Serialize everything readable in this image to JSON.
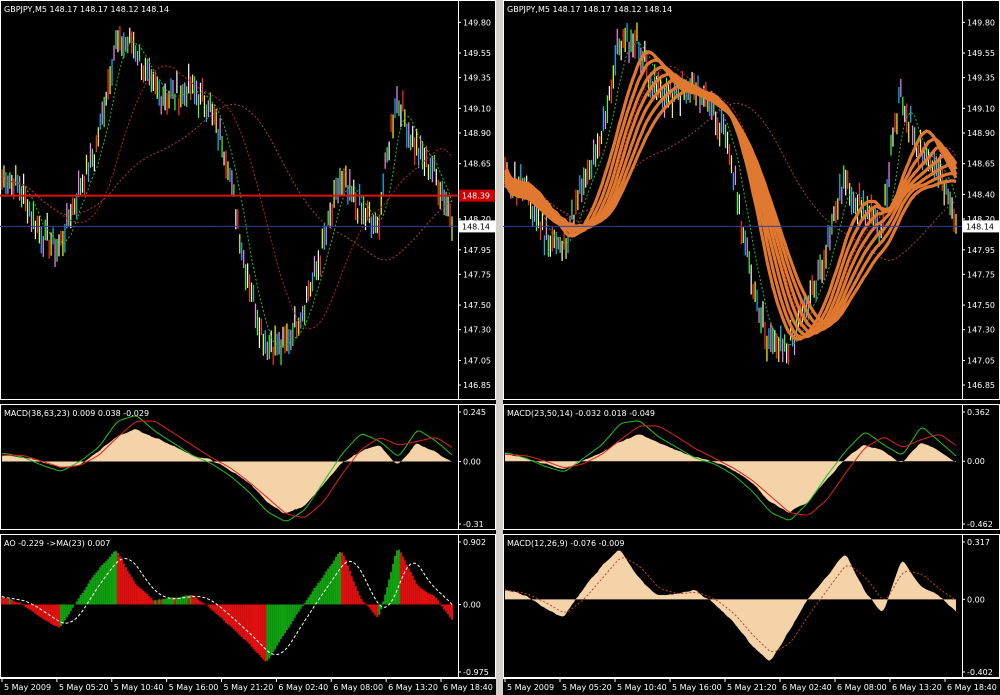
{
  "windows": [
    {
      "id": "left",
      "price_info": "GBPJPY,M5  148.17 148.17 148.12 148.14",
      "price_ticks": [
        "149.80",
        "149.55",
        "149.35",
        "149.10",
        "148.90",
        "148.65",
        "148.40",
        "148.20",
        "147.95",
        "147.75",
        "147.50",
        "147.30",
        "147.05",
        "146.85"
      ],
      "marker_red": "148.39",
      "marker_current": "148.14",
      "ind1_label": "MACD(38,63,23) 0.009 0.038 -0.029",
      "ind1_ticks": [
        "0.245",
        "0.00",
        "-0.31"
      ],
      "ind2_label": "AO -0.229  ->MA(23) 0.007",
      "ind2_ticks": [
        "0.902",
        "0.00",
        "-0.975"
      ],
      "time_labels": [
        "5 May 2009",
        "5 May 05:20",
        "5 May 10:40",
        "5 May 16:00",
        "5 May 21:20",
        "6 May 02:40",
        "6 May 08:00",
        "6 May 13:20",
        "6 May 18:40"
      ]
    },
    {
      "id": "right",
      "price_info": "GBPJPY,M5  148.17 148.17 148.12 148.14",
      "price_ticks": [
        "149.80",
        "149.55",
        "149.35",
        "149.10",
        "148.90",
        "148.65",
        "148.40",
        "148.20",
        "147.95",
        "147.75",
        "147.50",
        "147.30",
        "147.05",
        "146.85"
      ],
      "marker_current": "148.14",
      "ind1_label": "MACD(23,50,14) -0.032 0.018 -0.049",
      "ind1_ticks": [
        "0.362",
        "0.00",
        "-0.462"
      ],
      "ind2_label": "MACD(12,26,9) -0.076 -0.009",
      "ind2_ticks": [
        "0.317",
        "0.00",
        "-0.402"
      ],
      "time_labels": [
        "5 May 2009",
        "5 May 05:20",
        "5 May 10:40",
        "5 May 16:00",
        "5 May 21:20",
        "6 May 02:40",
        "6 May 08:00",
        "6 May 13:20",
        "6 May 18:40"
      ]
    }
  ],
  "chart_data": [
    {
      "type": "line",
      "title": "GBPJPY,M5",
      "x": [
        "5 May 2009",
        "5 May 05:20",
        "5 May 10:40",
        "5 May 16:00",
        "5 May 21:20",
        "6 May 02:40",
        "6 May 08:00",
        "6 May 13:20",
        "6 May 18:40"
      ],
      "y_unit": "price",
      "ylim": [
        146.85,
        149.9
      ],
      "series": [
        {
          "values": [
            148.55,
            148.45,
            148.1,
            147.95,
            148.4,
            148.75,
            149.6,
            149.65,
            149.25,
            149.2,
            149.25,
            149.15,
            148.7,
            147.8,
            147.2,
            147.15,
            147.45,
            147.9,
            148.5,
            148.3,
            148.1,
            149.2,
            148.8,
            148.6,
            148.2
          ]
        }
      ]
    },
    {
      "type": "line",
      "title": "GBPJPY,M5",
      "x": [
        "5 May 2009",
        "5 May 05:20",
        "5 May 10:40",
        "5 May 16:00",
        "5 May 21:20",
        "6 May 02:40",
        "6 May 08:00",
        "6 May 13:20",
        "6 May 18:40"
      ],
      "y_unit": "price",
      "ylim": [
        146.85,
        149.9
      ],
      "series": [
        {
          "values": [
            148.55,
            148.45,
            148.1,
            147.95,
            148.4,
            148.75,
            149.6,
            149.65,
            149.25,
            149.2,
            149.25,
            149.15,
            148.7,
            147.8,
            147.2,
            147.15,
            147.45,
            147.9,
            148.5,
            148.3,
            148.1,
            149.2,
            148.8,
            148.6,
            148.2
          ]
        }
      ]
    },
    {
      "type": "bar",
      "title": "MACD(38,63,23)",
      "ylim": [
        -0.31,
        0.245
      ],
      "values": [
        0.03,
        0.02,
        0.0,
        -0.03,
        -0.02,
        0.05,
        0.12,
        0.16,
        0.12,
        0.08,
        0.03,
        0.01,
        -0.04,
        -0.1,
        -0.2,
        -0.26,
        -0.22,
        -0.12,
        -0.01,
        0.05,
        0.08,
        -0.02,
        0.09,
        0.05,
        -0.01
      ],
      "series": [
        {
          "values": [
            0.04,
            0.02,
            -0.02,
            -0.05,
            0.0,
            0.07,
            0.2,
            0.23,
            0.15,
            0.09,
            0.03,
            -0.01,
            -0.07,
            -0.15,
            -0.25,
            -0.3,
            -0.24,
            -0.1,
            0.04,
            0.14,
            0.1,
            0.02,
            0.16,
            0.1,
            0.02
          ]
        },
        {
          "values": [
            0.03,
            0.03,
            0.0,
            -0.03,
            -0.02,
            0.03,
            0.12,
            0.2,
            0.2,
            0.14,
            0.08,
            0.02,
            -0.03,
            -0.1,
            -0.18,
            -0.26,
            -0.28,
            -0.2,
            -0.06,
            0.06,
            0.12,
            0.08,
            0.1,
            0.12,
            0.06
          ]
        }
      ]
    },
    {
      "type": "bar",
      "title": "AO",
      "ylim": [
        -0.975,
        0.902
      ],
      "values": [
        0.1,
        0.0,
        -0.2,
        -0.35,
        0.1,
        0.5,
        0.8,
        0.3,
        0.05,
        0.1,
        0.15,
        -0.05,
        -0.3,
        -0.55,
        -0.85,
        -0.4,
        0.0,
        0.4,
        0.8,
        0.1,
        -0.2,
        0.85,
        0.3,
        0.1,
        -0.25
      ],
      "series": [
        {
          "values": [
            0.1,
            0.05,
            -0.1,
            -0.25,
            -0.05,
            0.3,
            0.6,
            0.45,
            0.2,
            0.1,
            0.12,
            0.02,
            -0.2,
            -0.45,
            -0.7,
            -0.6,
            -0.2,
            0.2,
            0.6,
            0.35,
            0.0,
            0.55,
            0.45,
            0.2,
            0.0
          ]
        }
      ]
    },
    {
      "type": "bar",
      "title": "MACD(23,50,14)",
      "ylim": [
        -0.462,
        0.362
      ],
      "values": [
        0.05,
        0.02,
        -0.02,
        -0.06,
        0.0,
        0.06,
        0.14,
        0.2,
        0.14,
        0.08,
        0.03,
        0.0,
        -0.06,
        -0.15,
        -0.3,
        -0.38,
        -0.3,
        -0.14,
        0.02,
        0.12,
        0.08,
        -0.02,
        0.14,
        0.08,
        -0.02
      ],
      "series": [
        {
          "values": [
            0.06,
            0.02,
            -0.04,
            -0.08,
            0.02,
            0.12,
            0.28,
            0.3,
            0.18,
            0.1,
            0.02,
            -0.02,
            -0.1,
            -0.22,
            -0.38,
            -0.44,
            -0.3,
            -0.1,
            0.08,
            0.22,
            0.12,
            0.04,
            0.26,
            0.14,
            0.02
          ]
        },
        {
          "values": [
            0.05,
            0.04,
            0.0,
            -0.05,
            -0.02,
            0.05,
            0.16,
            0.26,
            0.26,
            0.18,
            0.09,
            0.02,
            -0.05,
            -0.14,
            -0.26,
            -0.38,
            -0.4,
            -0.28,
            -0.08,
            0.1,
            0.18,
            0.1,
            0.16,
            0.2,
            0.1
          ]
        }
      ]
    },
    {
      "type": "bar",
      "title": "MACD(12,26,9)",
      "ylim": [
        -0.402,
        0.317
      ],
      "values": [
        0.05,
        0.02,
        -0.05,
        -0.1,
        0.05,
        0.18,
        0.28,
        0.12,
        0.02,
        0.03,
        0.05,
        -0.02,
        -0.12,
        -0.25,
        -0.35,
        -0.18,
        0.0,
        0.12,
        0.26,
        0.05,
        -0.08,
        0.22,
        0.08,
        0.02,
        -0.08
      ],
      "series": [
        {
          "values": [
            0.05,
            0.03,
            -0.02,
            -0.08,
            0.0,
            0.12,
            0.24,
            0.18,
            0.06,
            0.03,
            0.04,
            0.0,
            -0.08,
            -0.2,
            -0.3,
            -0.24,
            -0.08,
            0.06,
            0.2,
            0.12,
            -0.02,
            0.16,
            0.14,
            0.05,
            -0.02
          ]
        }
      ]
    }
  ]
}
